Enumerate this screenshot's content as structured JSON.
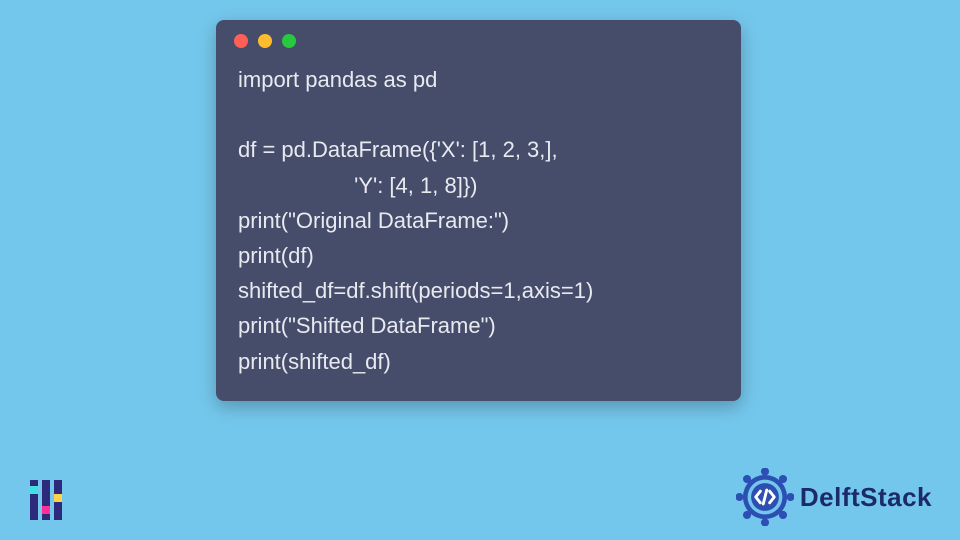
{
  "code": {
    "language": "python",
    "lines": [
      "import pandas as pd",
      "",
      "df = pd.DataFrame({'X': [1, 2, 3,],",
      "                   'Y': [4, 1, 8]})",
      "print(\"Original DataFrame:\")",
      "print(df)",
      "shifted_df=df.shift(periods=1,axis=1)",
      "print(\"Shifted DataFrame\")",
      "print(shifted_df)"
    ]
  },
  "window": {
    "dot_colors": [
      "#ff5f56",
      "#ffbd2e",
      "#27c93f"
    ]
  },
  "brand": {
    "name": "DelftStack"
  },
  "colors": {
    "page_bg": "#74c7ec",
    "code_bg": "#464d6b",
    "code_fg": "#e8eaf0",
    "brand_fg": "#1b2a6b"
  }
}
